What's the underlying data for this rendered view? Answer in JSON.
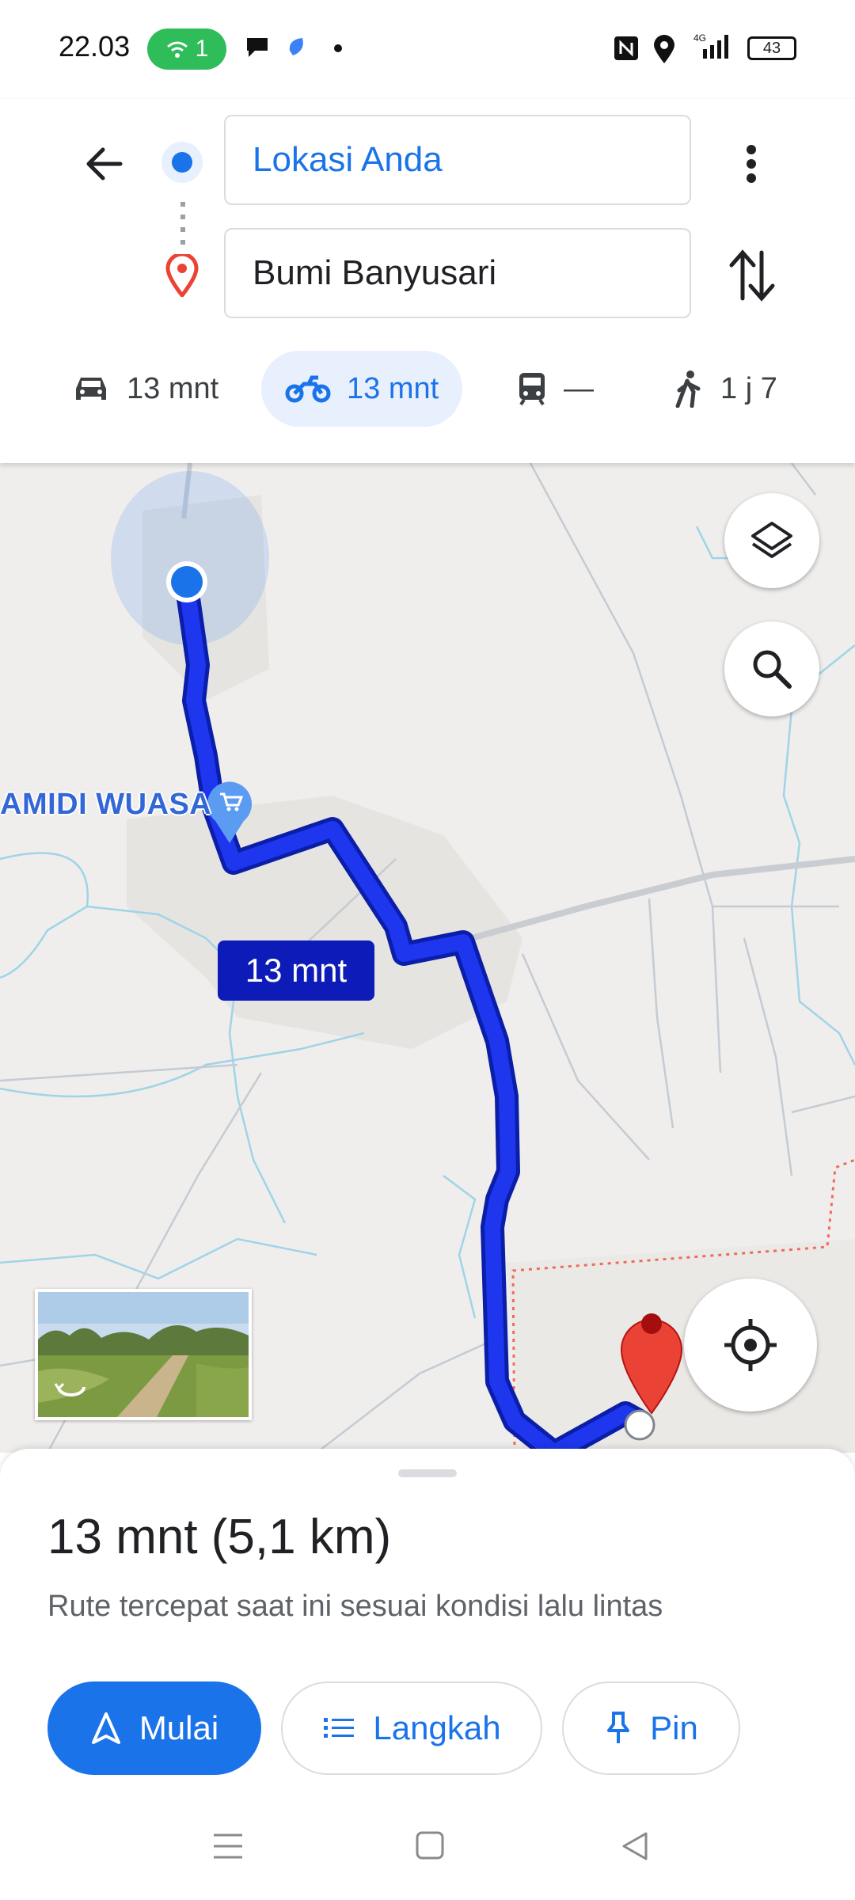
{
  "status_bar": {
    "time": "22.03",
    "wifi_count": "1",
    "battery": "43",
    "network": "4G"
  },
  "search": {
    "origin": "Lokasi Anda",
    "destination": "Bumi Banyusari"
  },
  "modes": [
    {
      "icon": "car-icon",
      "label": "13 mnt"
    },
    {
      "icon": "motorcycle-icon",
      "label": "13 mnt"
    },
    {
      "icon": "transit-icon",
      "label": "—"
    },
    {
      "icon": "walk-icon",
      "label": "1 j 7"
    }
  ],
  "map": {
    "poi_label": "AMIDI WUASA",
    "route_time": "13 mnt"
  },
  "route": {
    "summary": "13 mnt (5,1 km)",
    "description": "Rute tercepat saat ini sesuai kondisi lalu lintas",
    "start_label": "Mulai",
    "steps_label": "Langkah",
    "pin_label": "Pin"
  },
  "colors": {
    "accent": "#1a73e8",
    "route": "#1a2ee8",
    "destination": "#ea4335"
  }
}
